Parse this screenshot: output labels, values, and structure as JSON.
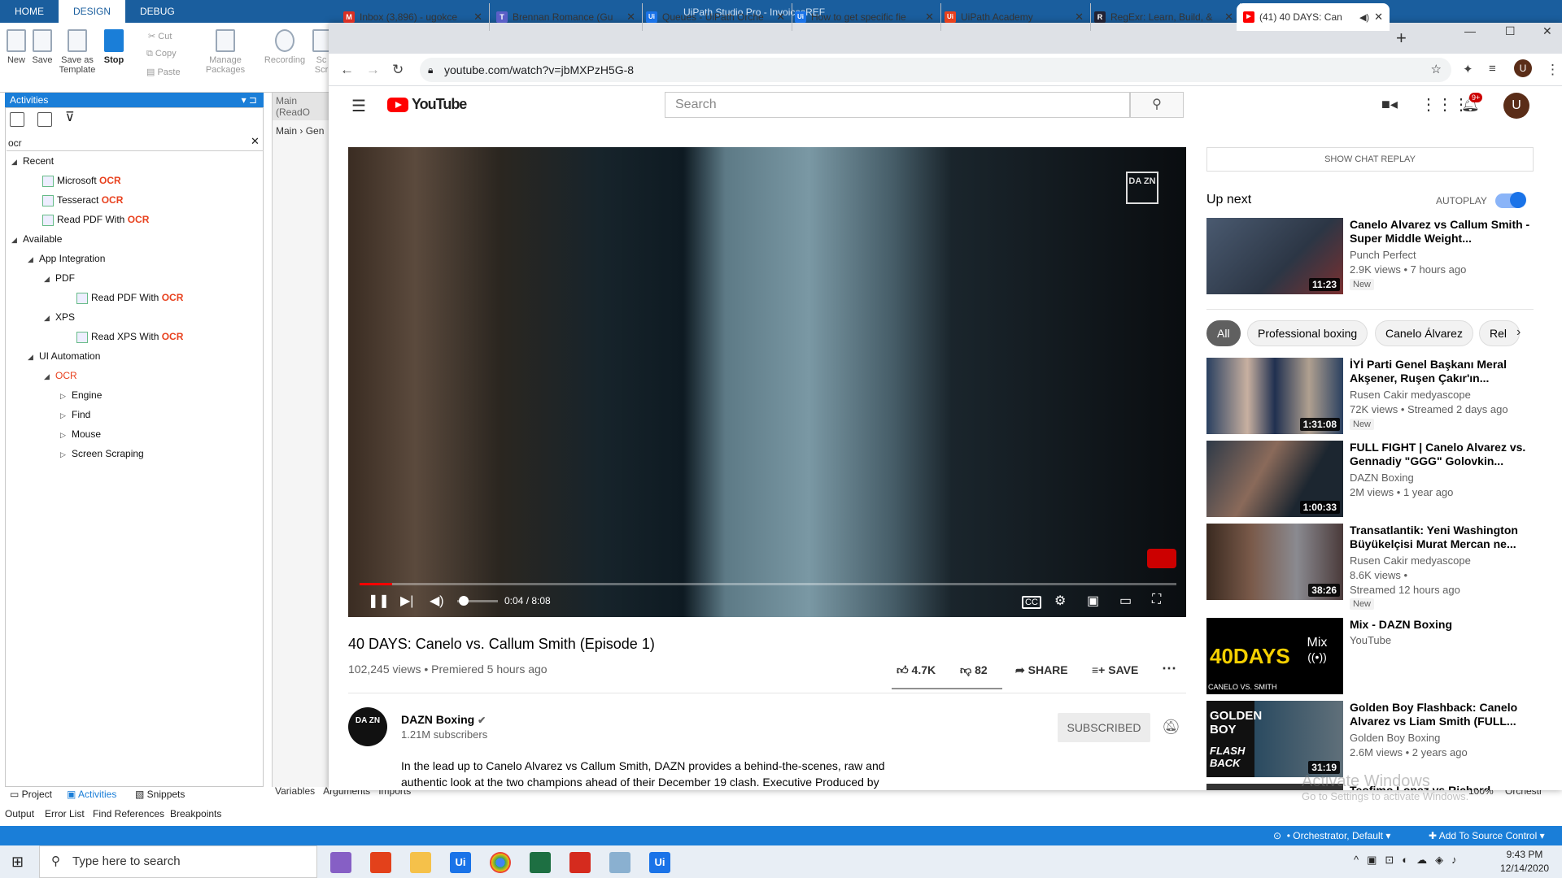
{
  "uipath": {
    "tabs": [
      "HOME",
      "DESIGN",
      "DEBUG"
    ],
    "title": "UiPath Studio Pro - InvoicesREF",
    "ribbon": {
      "new": "New",
      "save": "Save",
      "save_as_template_1": "Save as",
      "save_as_template_2": "Template",
      "stop": "Stop",
      "cut": "Cut",
      "copy": "Copy",
      "paste": "Paste",
      "manage_packages_1": "Manage",
      "manage_packages_2": "Packages",
      "recording": "Recording",
      "screen_scraping": "Sc Scr"
    },
    "activities_title": "Activities",
    "search_value": "ocr",
    "tree": {
      "recent": "Recent",
      "microsoft": "Microsoft",
      "tesseract": "Tesseract",
      "read_pdf": "Read PDF With",
      "ocr": "OCR",
      "available": "Available",
      "app_integration": "App Integration",
      "pdf": "PDF",
      "xps": "XPS",
      "read_xps": "Read XPS With",
      "ui_automation": "UI Automation",
      "engine": "Engine",
      "find": "Find",
      "mouse": "Mouse",
      "screen_scraping": "Screen Scraping"
    },
    "main_tab": "Main (ReadO",
    "breadcrumb_main": "Main",
    "breadcrumb_gen": "Gen",
    "bottom_tabs": {
      "project": "Project",
      "activities": "Activities",
      "snippets": "Snippets"
    },
    "bottom_tabs2": {
      "output": "Output",
      "error_list": "Error List",
      "find_refs": "Find References",
      "breakpoints": "Breakpoints"
    },
    "designer_tabs": {
      "variables": "Variables",
      "arguments": "Arguments",
      "imports": "Imports"
    },
    "zoom": "100%",
    "orchestrator_tab": "Orchestr",
    "status_orchestrator": "Orchestrator, Default",
    "status_source": "Add To Source Control"
  },
  "taskbar": {
    "search_placeholder": "Type here to search",
    "time": "9:43 PM",
    "date": "12/14/2020"
  },
  "browser": {
    "tabs": [
      {
        "title": "Inbox (3,896) - ugokce",
        "fav": "M",
        "color": "#d93025"
      },
      {
        "title": "Brennan Romance (Gu",
        "fav": "T",
        "color": "#5b5fc7"
      },
      {
        "title": "Queues - UiPath Orche",
        "fav": "Ui",
        "color": "#1a73e8"
      },
      {
        "title": "How to get specific fie",
        "fav": "Ui",
        "color": "#1a73e8"
      },
      {
        "title": "UiPath Academy",
        "fav": "Ui",
        "color": "#e8411e"
      },
      {
        "title": "RegExr: Learn, Build, &",
        "fav": "R",
        "color": "#223"
      },
      {
        "title": "(41) 40 DAYS: Can",
        "fav": "▶",
        "color": "#f00"
      }
    ],
    "url": "youtube.com/watch?v=jbMXPzH5G-8"
  },
  "youtube": {
    "logo_text": "YouTube",
    "search_placeholder": "Search",
    "notif_count": "9+",
    "avatar_letter": "U",
    "player": {
      "watermark": "DA ZN",
      "time": "0:04 / 8:08",
      "progress": 0.008
    },
    "video_title": "40 DAYS: Canelo vs. Callum Smith (Episode 1)",
    "video_meta": "102,245 views • Premiered 5 hours ago",
    "likes": "4.7K",
    "dislikes": "82",
    "share": "SHARE",
    "save": "SAVE",
    "channel": {
      "name": "DAZN Boxing",
      "subs": "1.21M subscribers",
      "subscribe_label": "SUBSCRIBED",
      "avatar_text": "DA ZN"
    },
    "description": "In the lead up to Canelo Alvarez vs Callum Smith, DAZN provides a behind-the-scenes, raw and authentic look at the two champions ahead of their December 19 clash. Executive Produced by",
    "chat_replay": "SHOW CHAT REPLAY",
    "up_next": "Up next",
    "autoplay": "AUTOPLAY",
    "chips": [
      "All",
      "Professional boxing",
      "Canelo Álvarez",
      "Rel"
    ],
    "recommendations": [
      {
        "title": "Canelo Alvarez vs Callum Smith - Super Middle Weight...",
        "channel": "Punch Perfect",
        "views": "2.9K views • 7 hours ago",
        "new": "New",
        "duration": "11:23"
      },
      {
        "title": "İYİ Parti Genel Başkanı Meral Akşener, Ruşen Çakır'ın...",
        "channel": "Rusen Cakir medyascope",
        "views": "72K views • Streamed 2 days ago",
        "new": "New",
        "duration": "1:31:08"
      },
      {
        "title": "FULL FIGHT | Canelo Alvarez vs. Gennadiy \"GGG\" Golovkin...",
        "channel": "DAZN Boxing",
        "views": "2M views • 1 year ago",
        "duration": "1:00:33"
      },
      {
        "title": "Transatlantik: Yeni Washington Büyükelçisi Murat Mercan ne...",
        "channel": "Rusen Cakir medyascope",
        "views": "8.6K views •",
        "views2": "Streamed 12 hours ago",
        "new": "New",
        "duration": "38:26"
      },
      {
        "title": "Mix - DAZN Boxing",
        "channel": "YouTube",
        "mix": "Mix"
      },
      {
        "title": "Golden Boy Flashback: Canelo Alvarez vs Liam Smith (FULL...",
        "channel": "Golden Boy Boxing",
        "views": "2.6M views • 2 years ago",
        "duration": "31:19"
      },
      {
        "title": "Teofimo Lopez vs Richard..."
      }
    ],
    "thumb_texts": {
      "mix_title": "40DAYS",
      "mix_sub": "CANELO VS. SMITH",
      "golden": "GOLDEN BOY",
      "flashback": "FLASH BACK"
    }
  },
  "watermark": {
    "line1": "Activate Windows",
    "line2": "Go to Settings to activate Windows."
  }
}
